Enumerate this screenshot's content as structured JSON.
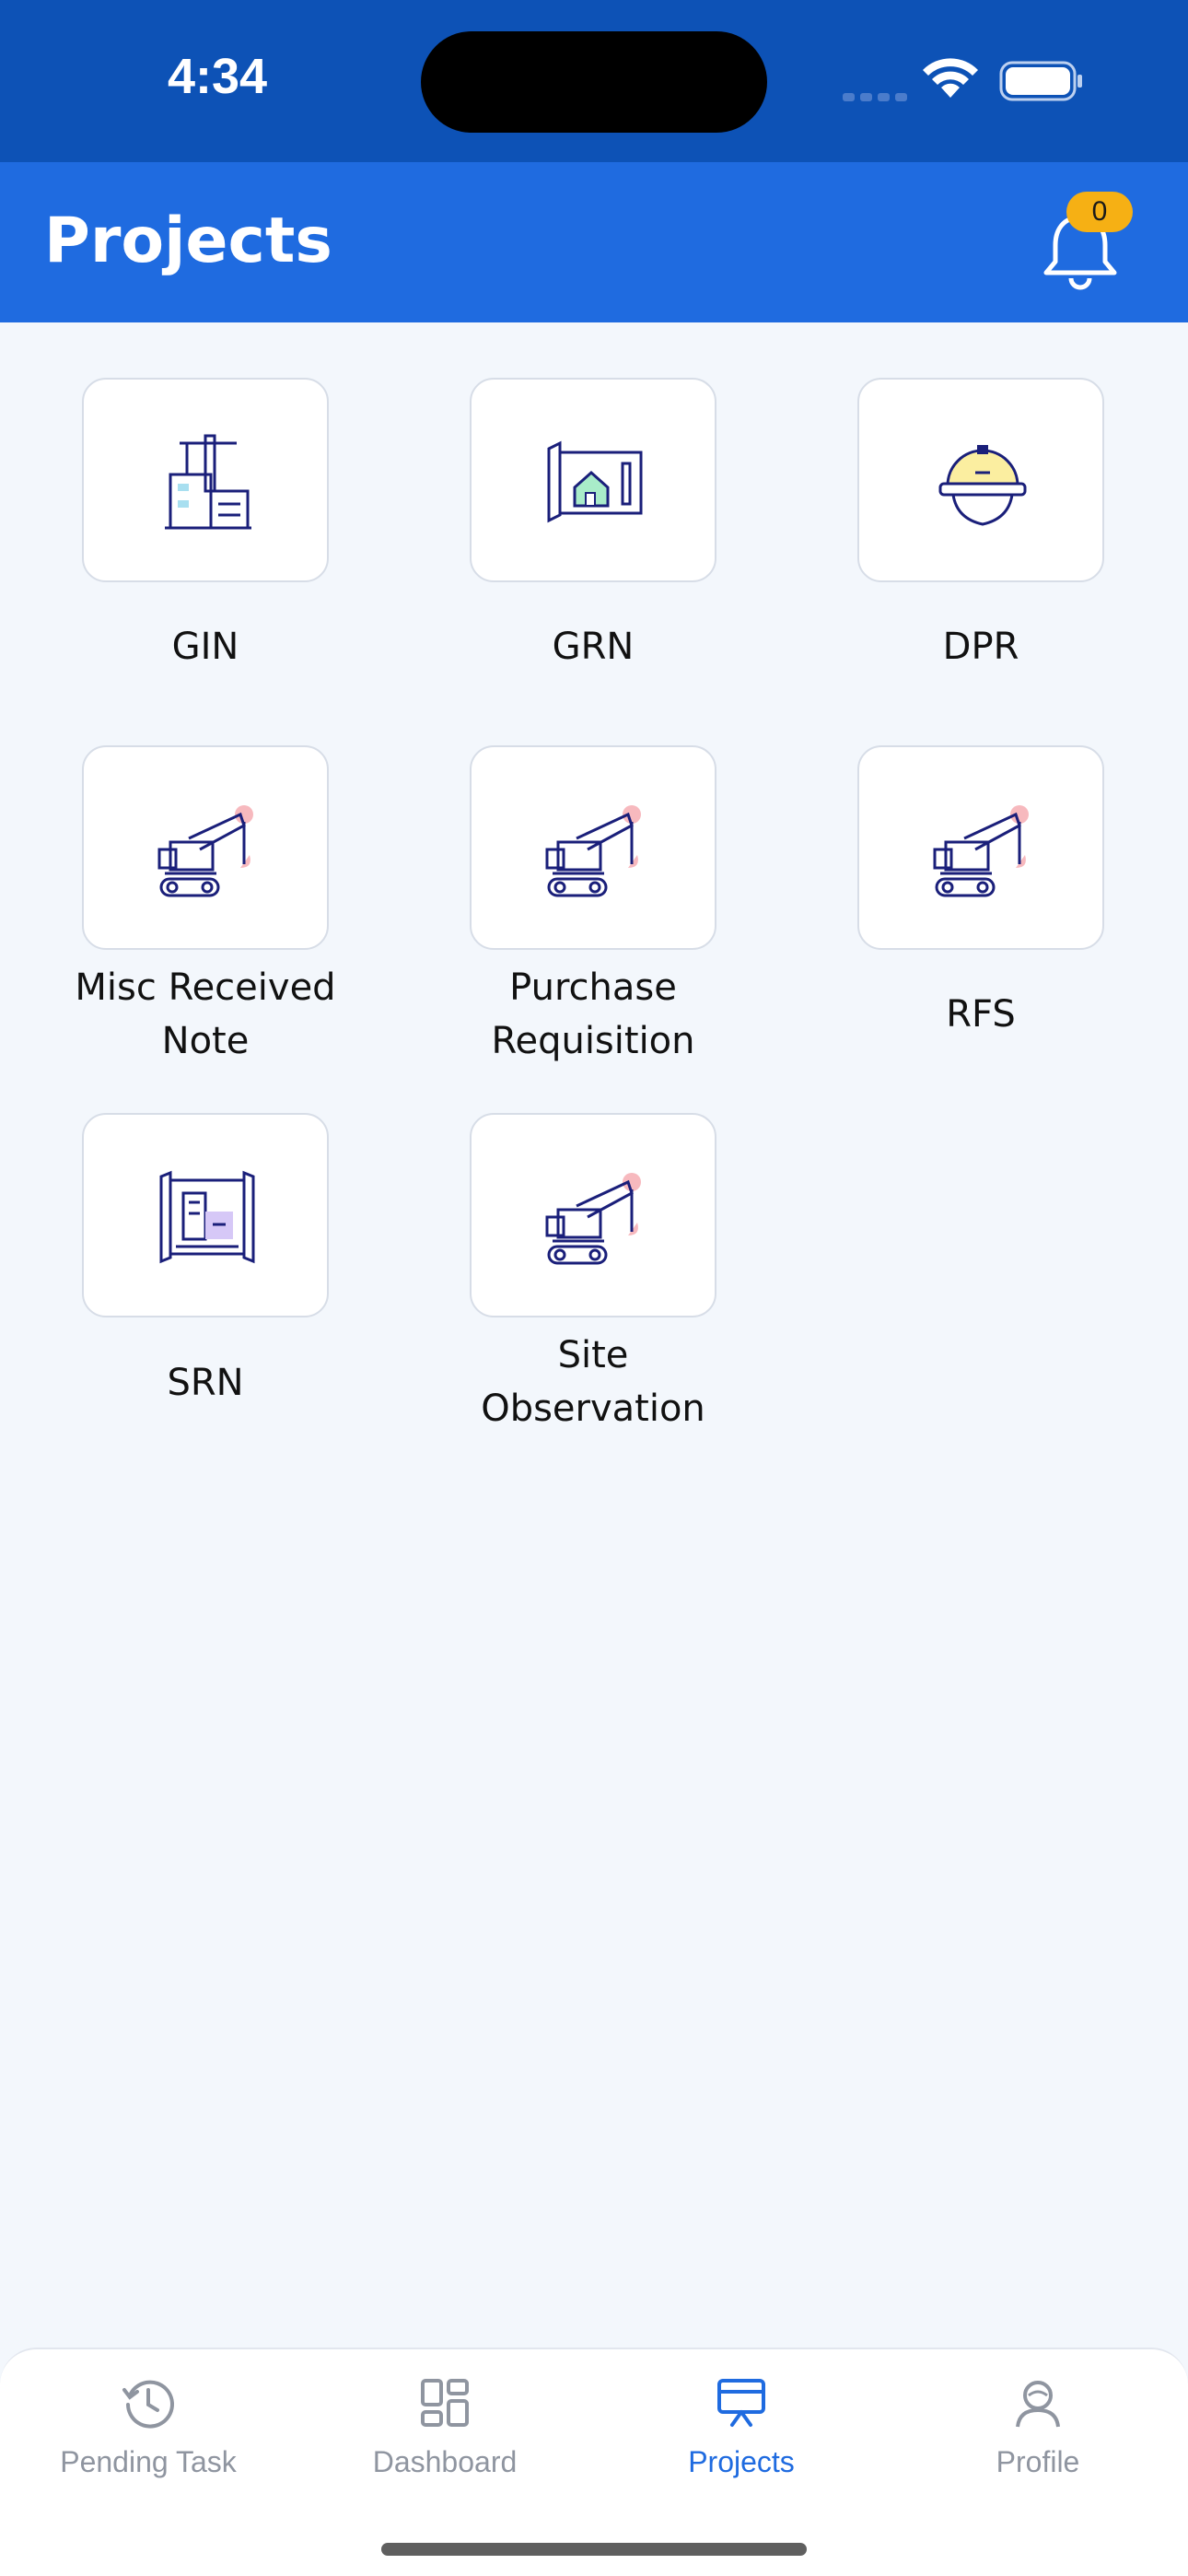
{
  "status_bar": {
    "time": "4:34"
  },
  "header": {
    "title": "Projects",
    "notification_count": "0"
  },
  "tiles": [
    {
      "label": "GIN",
      "icon": "building-crane-icon"
    },
    {
      "label": "GRN",
      "icon": "house-blueprint-icon"
    },
    {
      "label": "DPR",
      "icon": "hard-hat-icon"
    },
    {
      "label": "Misc Received\nNote",
      "icon": "excavator-icon"
    },
    {
      "label": "Purchase\nRequisition",
      "icon": "excavator-icon"
    },
    {
      "label": "RFS",
      "icon": "excavator-icon"
    },
    {
      "label": "SRN",
      "icon": "building-plan-icon"
    },
    {
      "label": "Site\nObservation",
      "icon": "excavator-icon"
    }
  ],
  "bottom_nav": {
    "items": [
      {
        "label": "Pending Task",
        "icon": "clock-icon",
        "active": false
      },
      {
        "label": "Dashboard",
        "icon": "dashboard-grid-icon",
        "active": false
      },
      {
        "label": "Projects",
        "icon": "presentation-board-icon",
        "active": true
      },
      {
        "label": "Profile",
        "icon": "user-avatar-icon",
        "active": false
      }
    ]
  },
  "colors": {
    "status_bar": "#0d52b6",
    "header": "#1f6be0",
    "badge": "#f6b014",
    "background": "#f3f7fc",
    "active_nav": "#1f6be0",
    "inactive_nav": "#8f95a0"
  }
}
